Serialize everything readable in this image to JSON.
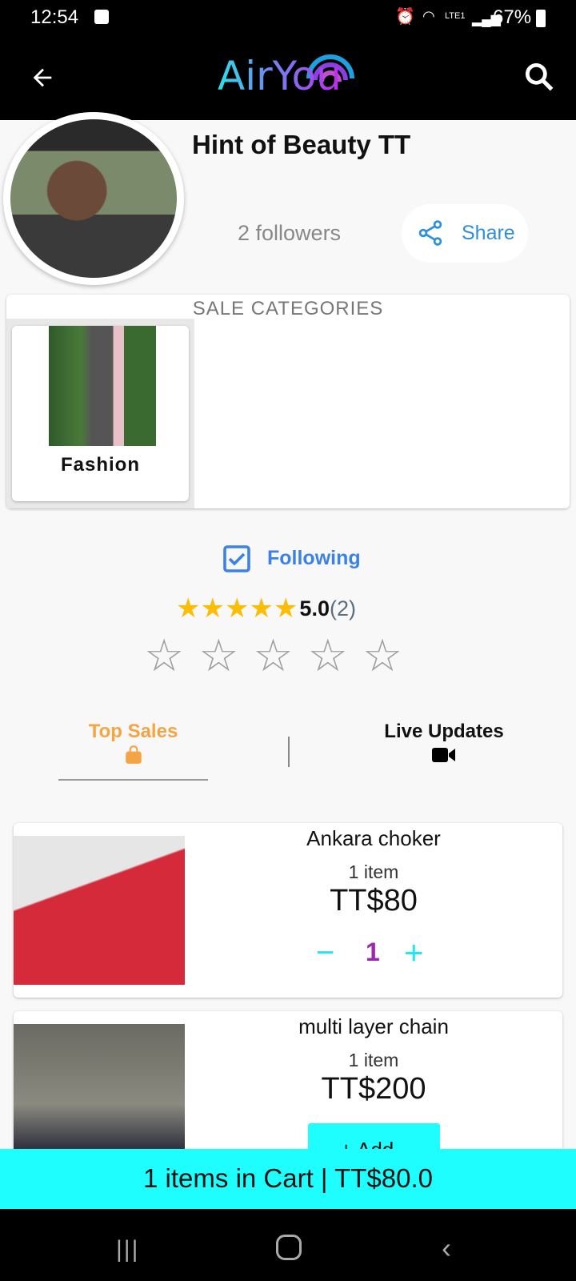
{
  "status_bar": {
    "time": "12:54",
    "battery": "67%",
    "network": "LTE1"
  },
  "app_bar": {
    "logo": "AirYou"
  },
  "profile": {
    "name": "Hint of Beauty TT",
    "followers": "2 followers",
    "share_label": "Share"
  },
  "sale_categories": {
    "title": "SALE CATEGORIES",
    "items": [
      {
        "label": "Fashion"
      }
    ]
  },
  "follow": {
    "label": "Following",
    "checked": true
  },
  "rating": {
    "value": "5.0",
    "count": "(2)",
    "stars": 5,
    "user_rating": 0
  },
  "tabs": [
    {
      "label": "Top Sales",
      "active": true
    },
    {
      "label": "Live Updates",
      "active": false
    }
  ],
  "products": [
    {
      "name": "Ankara choker",
      "qty_label": "1 item",
      "price": "TT$80",
      "quantity": "1"
    },
    {
      "name": "multi layer chain",
      "qty_label": "1 item",
      "price": "TT$200",
      "add_label": "Add"
    }
  ],
  "cart": {
    "summary": "1 items in Cart | TT$80.0"
  },
  "colors": {
    "accent": "#1ffefe",
    "active_tab": "#f5a443",
    "link": "#3b82e6",
    "quantity": "#9c27b0"
  }
}
